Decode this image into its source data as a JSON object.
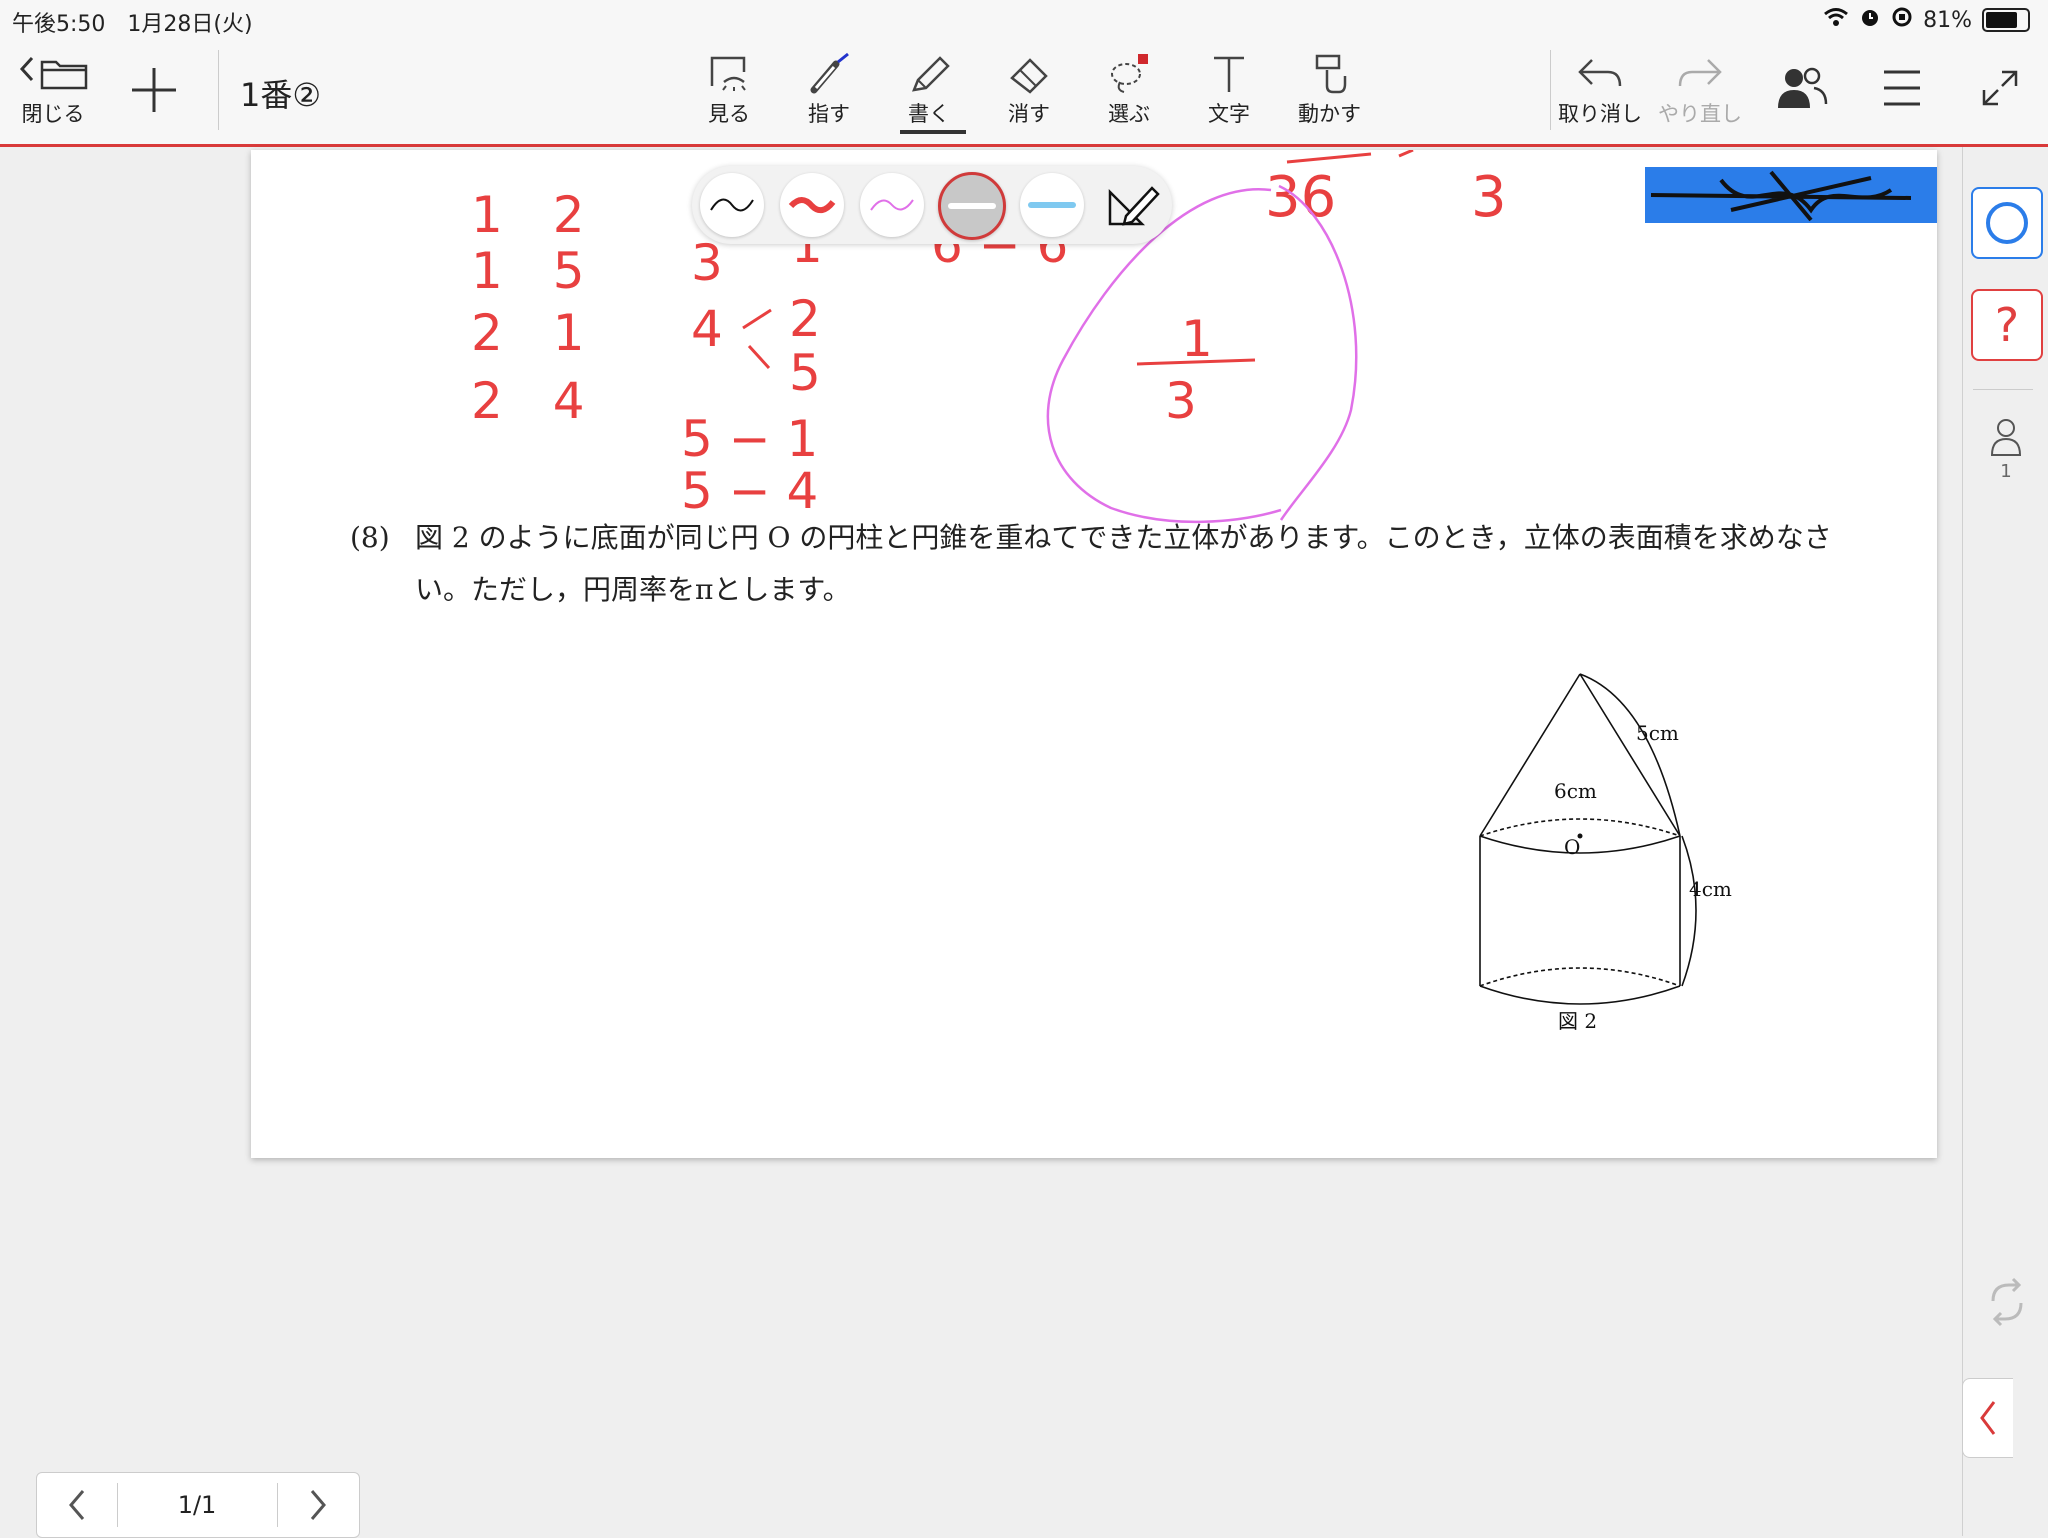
{
  "status_bar": {
    "time_date": "午後5:50　1月28日(火)",
    "battery_text": "81%",
    "battery_level": 0.81
  },
  "toolbar": {
    "close_label": "閉じる",
    "doc_title": "1番②",
    "tools": [
      {
        "label": "見る",
        "icon": "view-icon"
      },
      {
        "label": "指す",
        "icon": "laser-pointer-icon"
      },
      {
        "label": "書く",
        "icon": "pencil-icon",
        "active": true
      },
      {
        "label": "消す",
        "icon": "eraser-icon"
      },
      {
        "label": "選ぶ",
        "icon": "lasso-select-icon"
      },
      {
        "label": "文字",
        "icon": "text-icon"
      },
      {
        "label": "動かす",
        "icon": "move-icon"
      }
    ],
    "undo_label": "取り消し",
    "redo_label": "やり直し",
    "accent_color": "#d93a3a"
  },
  "pen_palette": {
    "pens": [
      {
        "name": "thin-black",
        "color": "#111111"
      },
      {
        "name": "thick-red",
        "color": "#e84040"
      },
      {
        "name": "thin-pink",
        "color": "#e070e8"
      },
      {
        "name": "white-marker",
        "color": "#ffffff",
        "selected": true
      },
      {
        "name": "lightblue-marker",
        "color": "#7fc9f0"
      }
    ]
  },
  "question": {
    "number": "(8)",
    "text": "図 2 のように底面が同じ円 O の円柱と円錐を重ねてできた立体があります。このとき，立体の表面積を求めなさい。ただし，円周率をπとします。"
  },
  "figure": {
    "slant_label": "5cm",
    "diameter_label": "6cm",
    "center_label": "O",
    "height_label": "4cm",
    "caption": "図 2"
  },
  "handwriting": {
    "col1": [
      "1　2",
      "1　5",
      "2　1",
      "2　4"
    ],
    "col2": [
      "3",
      "4",
      "2",
      "5",
      "5 − 1",
      "5 − 4"
    ],
    "top_right": [
      "36",
      "3"
    ],
    "fraction_num": "1",
    "fraction_den": "3",
    "stray_marks": [
      "1",
      "6 − 6"
    ],
    "ink_red": "#e84040",
    "ink_pink": "#e070e8"
  },
  "sidebar": {
    "answer_circle": "○",
    "answer_question": "?",
    "participant_count": "1"
  },
  "pager": {
    "page_label": "1/1"
  },
  "top_right_button": {
    "color": "#2b7de9"
  }
}
